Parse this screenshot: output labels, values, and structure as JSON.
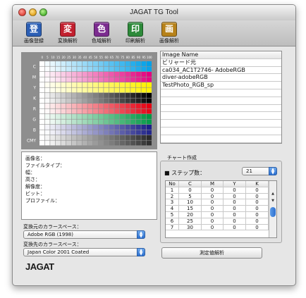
{
  "window": {
    "title": "JAGAT TG Tool"
  },
  "toolbar": {
    "buttons": [
      {
        "glyph": "登",
        "label": "画像登録",
        "color": "#2c5fb5"
      },
      {
        "glyph": "変",
        "label": "変換解析",
        "color": "#c2202f"
      },
      {
        "glyph": "色",
        "label": "色域解析",
        "color": "#7b2c8f"
      },
      {
        "glyph": "印",
        "label": "印刷解析",
        "color": "#2d8a3a"
      },
      {
        "glyph": "画",
        "label": "画像解析",
        "color": "#b7821a"
      }
    ]
  },
  "chart": {
    "columns": [
      "0",
      "5",
      "10",
      "15",
      "20",
      "25",
      "30",
      "35",
      "40",
      "45",
      "50",
      "55",
      "60",
      "65",
      "70",
      "75",
      "80",
      "85",
      "90",
      "95",
      "100"
    ],
    "rows": [
      "C",
      "M",
      "Y",
      "K",
      "R",
      "G",
      "B",
      "CMY"
    ],
    "row_colors": [
      "#00a0e9",
      "#e4007f",
      "#fff100",
      "#000000",
      "#e60012",
      "#009944",
      "#1d2088",
      "#2b2b2b"
    ]
  },
  "info": {
    "lines": [
      "画像名：",
      "ファイルタイプ：",
      "幅：",
      "高さ：",
      "解像度：",
      "ビット：",
      "プロファイル："
    ]
  },
  "source_space": {
    "label": "変換元のカラースペース：",
    "value": "Adobe RGB (1998)"
  },
  "dest_space": {
    "label": "変換先のカラースペース：",
    "value": "Japan Color 2001 Coated"
  },
  "logo": "JAGAT",
  "image_list": {
    "header": "Image Name",
    "items": [
      "ビリャード元",
      "ca034_AC1T2746- AdobeRGB",
      "diver-adobeRGB",
      "TestPhoto_RGB_sp"
    ]
  },
  "chart_create": {
    "title": "チャート作成",
    "steps_label": "■ ステップ数：",
    "steps_value": "21",
    "columns": [
      "No",
      "C",
      "M",
      "Y",
      "K"
    ],
    "rows": [
      [
        "1",
        "0",
        "0",
        "0",
        "0"
      ],
      [
        "2",
        "5",
        "0",
        "0",
        "0"
      ],
      [
        "3",
        "10",
        "0",
        "0",
        "0"
      ],
      [
        "4",
        "15",
        "0",
        "0",
        "0"
      ],
      [
        "5",
        "20",
        "0",
        "0",
        "0"
      ],
      [
        "6",
        "25",
        "0",
        "0",
        "0"
      ],
      [
        "7",
        "30",
        "0",
        "0",
        "0"
      ]
    ]
  },
  "measure_button": "測定値解析"
}
